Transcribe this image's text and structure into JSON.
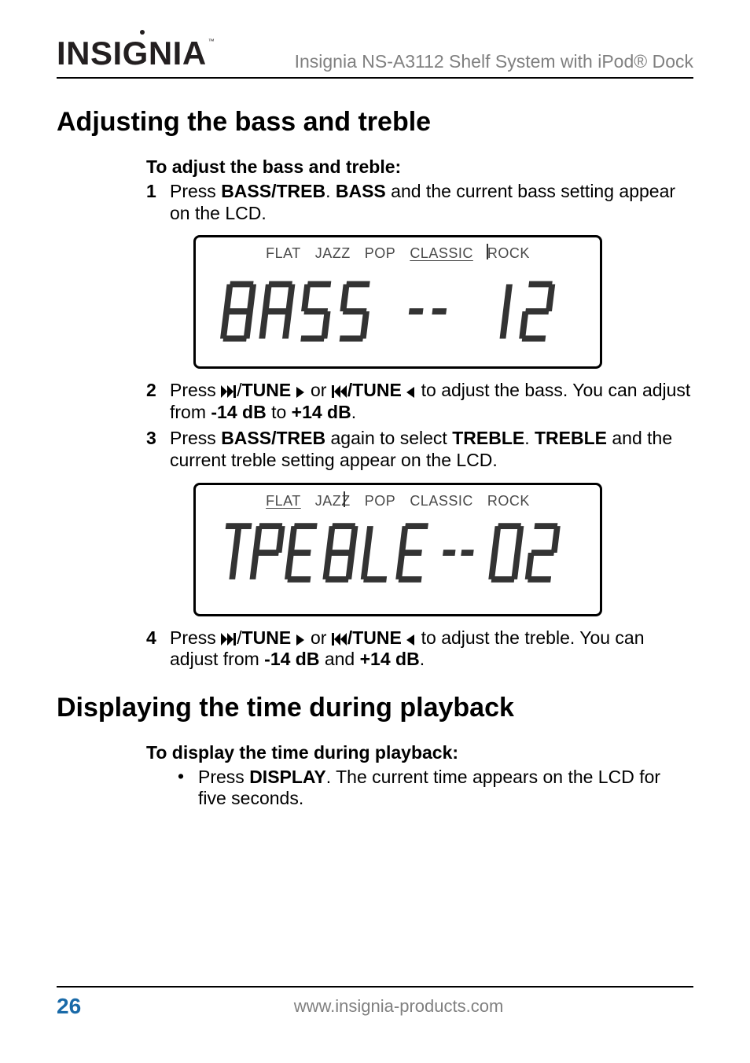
{
  "header": {
    "brand": "INSIGNIA",
    "tm": "™",
    "title": "Insignia NS-A3112 Shelf System with iPod® Dock"
  },
  "section1": {
    "title": "Adjusting the bass and treble",
    "subhead": "To adjust the bass and treble:",
    "step1_num": "1",
    "step1_a": "Press ",
    "step1_b": "BASS/TREB",
    "step1_c": ". ",
    "step1_d": "BASS",
    "step1_e": " and the current bass setting appear on the LCD.",
    "lcd1": {
      "presets": [
        "FLAT",
        "JAZZ",
        "POP",
        "CLASSIC",
        "ROCK"
      ],
      "selected": "CLASSIC"
    },
    "step2_num": "2",
    "step2_a": "Press ",
    "step2_tune1": "TUNE",
    "step2_b": " or ",
    "step2_tune2": "TUNE",
    "step2_c": " to adjust the bass. You can adjust from ",
    "step2_d": "-14 dB",
    "step2_e": " to ",
    "step2_f": "+14 dB",
    "step2_g": ".",
    "step3_num": "3",
    "step3_a": "Press ",
    "step3_b": "BASS/TREB",
    "step3_c": " again to select ",
    "step3_d": "TREBLE",
    "step3_e": ". ",
    "step3_f": "TREBLE",
    "step3_g": " and the current treble setting appear on the LCD.",
    "lcd2": {
      "presets": [
        "FLAT",
        "JAZZ",
        "POP",
        "CLASSIC",
        "ROCK"
      ],
      "selected": "FLAT"
    },
    "step4_num": "4",
    "step4_a": "Press ",
    "step4_tune1": "TUNE",
    "step4_b": " or ",
    "step4_tune2": "TUNE",
    "step4_c": " to adjust the treble. You can adjust from ",
    "step4_d": "-14 dB",
    "step4_e": " and ",
    "step4_f": "+14 dB",
    "step4_g": "."
  },
  "section2": {
    "title": "Displaying the time during playback",
    "subhead": "To display the time during playback:",
    "bullet_a": "Press ",
    "bullet_b": "DISPLAY",
    "bullet_c": ". The current time appears on the LCD for five seconds."
  },
  "footer": {
    "page": "26",
    "url": "www.insignia-products.com"
  }
}
